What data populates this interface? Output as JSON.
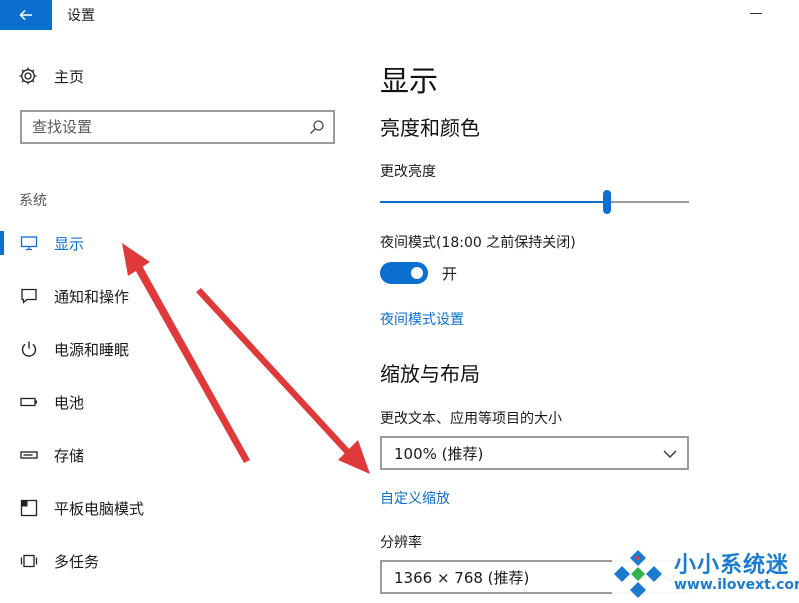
{
  "window": {
    "title": "设置"
  },
  "sidebar": {
    "home_label": "主页",
    "search_placeholder": "查找设置",
    "group_label": "系统",
    "items": [
      {
        "label": "显示",
        "icon": "monitor-icon",
        "active": true
      },
      {
        "label": "通知和操作",
        "icon": "notification-icon",
        "active": false
      },
      {
        "label": "电源和睡眠",
        "icon": "power-icon",
        "active": false
      },
      {
        "label": "电池",
        "icon": "battery-icon",
        "active": false
      },
      {
        "label": "存储",
        "icon": "storage-icon",
        "active": false
      },
      {
        "label": "平板电脑模式",
        "icon": "tablet-mode-icon",
        "active": false
      },
      {
        "label": "多任务",
        "icon": "multitasking-icon",
        "active": false
      }
    ]
  },
  "main": {
    "title": "显示",
    "brightness_section": "亮度和颜色",
    "brightness_label": "更改亮度",
    "brightness_value": 0.74,
    "night_mode_label": "夜间模式(18:00 之前保持关闭)",
    "night_mode_state": "开",
    "night_mode_settings_link": "夜间模式设置",
    "scale_section": "缩放与布局",
    "scale_label": "更改文本、应用等项目的大小",
    "scale_value": "100% (推荐)",
    "custom_scale_link": "自定义缩放",
    "resolution_label": "分辨率",
    "resolution_value": "1366 × 768 (推荐)"
  },
  "watermark": {
    "title": "小小系统迷",
    "url": "www.ilovext.com"
  },
  "colors": {
    "accent": "#0a6fcf",
    "annotation_arrow": "#e0393a",
    "watermark": "#1b7bd0"
  }
}
